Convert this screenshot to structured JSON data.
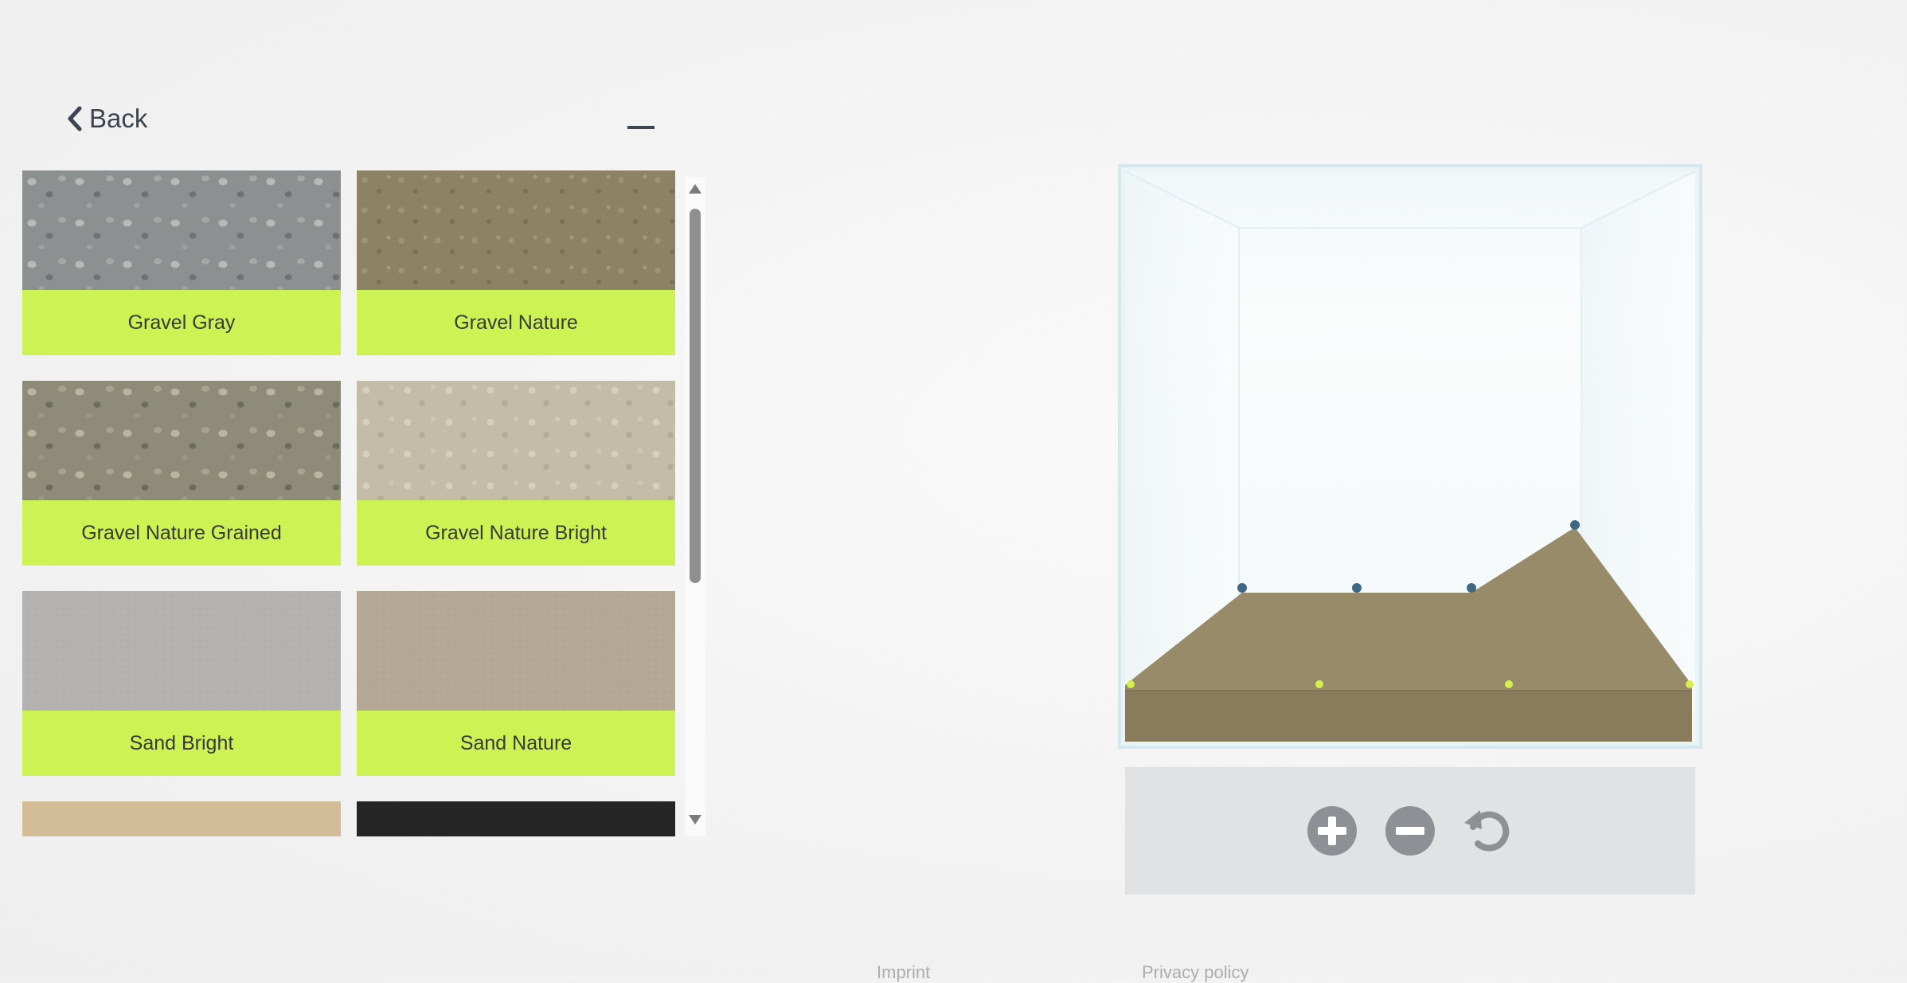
{
  "nav": {
    "back_label": "Back",
    "back_icon": "chevron-left-icon",
    "minimize_icon": "minimize-icon"
  },
  "materials": [
    {
      "label": "Gravel Gray",
      "swatch": "#8d9091"
    },
    {
      "label": "Gravel Nature",
      "swatch": "#8c8364"
    },
    {
      "label": "Gravel Nature Grained",
      "swatch": "#8e8c79"
    },
    {
      "label": "Gravel Nature Bright",
      "swatch": "#c4bca8"
    },
    {
      "label": "Sand Bright",
      "swatch": "#b4b2b0"
    },
    {
      "label": "Sand Nature",
      "swatch": "#b3a893"
    },
    {
      "label": "",
      "swatch": "#d3bd99"
    },
    {
      "label": "",
      "swatch": "#252525"
    }
  ],
  "controls": {
    "zoom_in_icon": "plus-circle-icon",
    "zoom_out_icon": "minus-circle-icon",
    "reset_icon": "reset-icon"
  },
  "footer": {
    "imprint_label": "Imprint",
    "privacy_label": "Privacy policy"
  },
  "colors": {
    "accent": "#cdf254",
    "handle_top": "#3f6885",
    "handle_bottom": "#d6ef4a",
    "substrate": "#978b6a",
    "controls_bg": "#e1e2e4",
    "control_icon": "#8d9094"
  }
}
